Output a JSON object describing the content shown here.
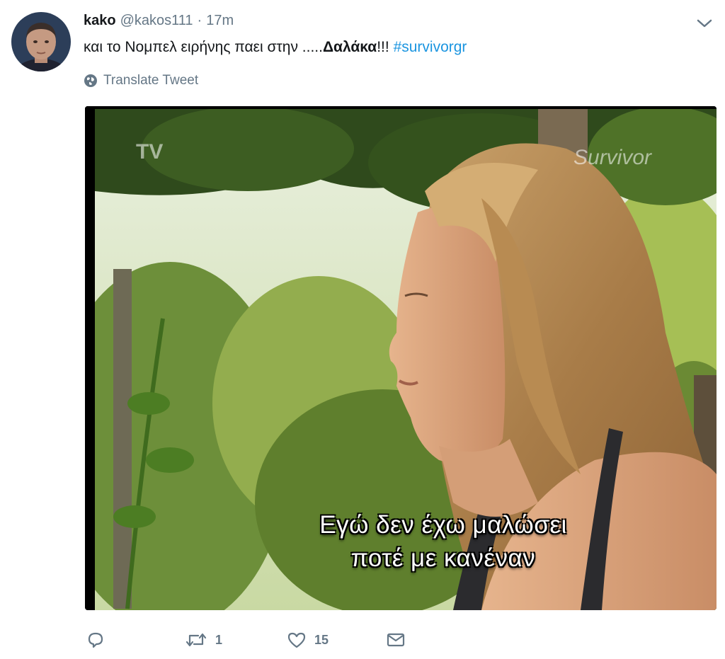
{
  "tweet": {
    "display_name": "kako",
    "handle": "@kakos111",
    "separator": "·",
    "time": "17m",
    "text_prefix": "και το Νομπελ ειρήνης παει στην .....",
    "text_bold": "Δαλάκα",
    "text_suffix": "!!! ",
    "hashtag": "#survivorgr",
    "translate_label": "Translate Tweet"
  },
  "media": {
    "watermark_left": "ΤV",
    "watermark_right": "Survivor",
    "subtitle_line1": "Εγώ δεν έχω μαλώσει",
    "subtitle_line2": "ποτέ με κανέναν"
  },
  "actions": {
    "retweet_count": "1",
    "like_count": "15"
  },
  "icons": {
    "caret": "chevron-down-icon",
    "translate": "globe-icon",
    "reply": "reply-icon",
    "retweet": "retweet-icon",
    "like": "heart-icon",
    "dm": "envelope-icon"
  },
  "colors": {
    "text": "#14171a",
    "secondary": "#657786",
    "link": "#1b95e0"
  }
}
